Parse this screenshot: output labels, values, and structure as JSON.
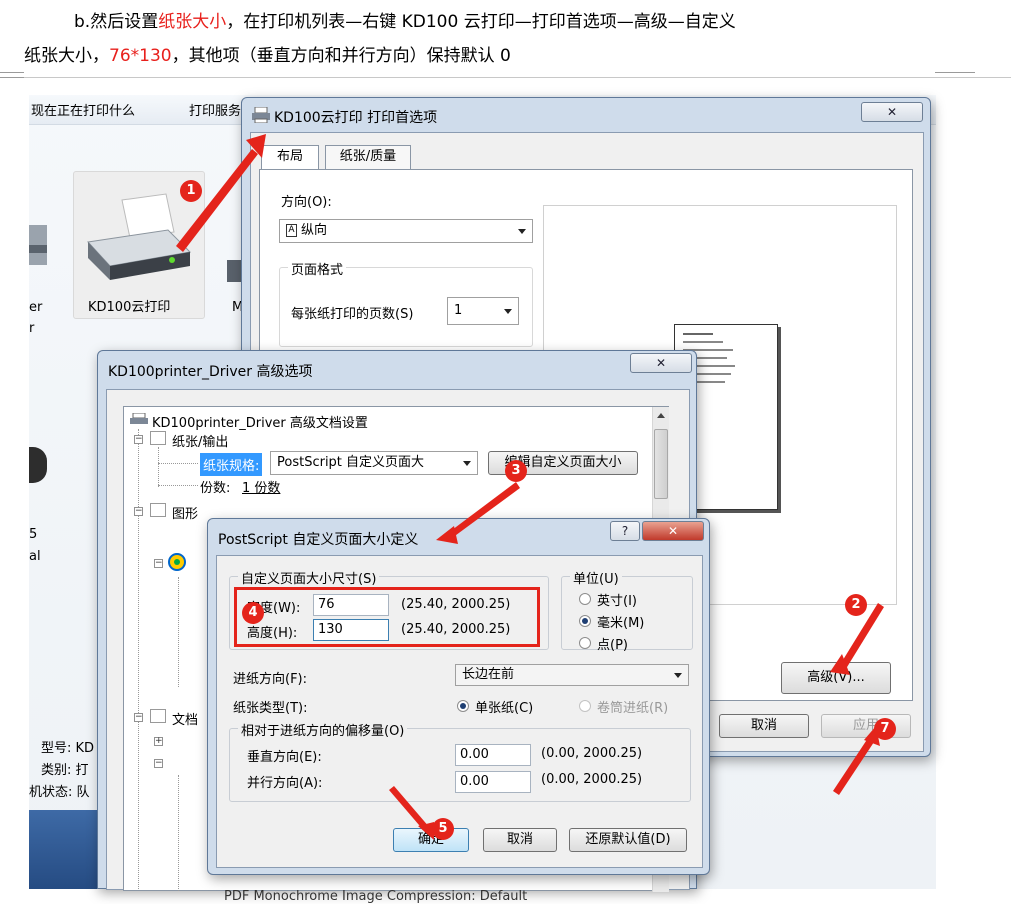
{
  "doc": {
    "line1_a": "b.然后设置",
    "line1_red": "纸张大小",
    "line1_b": "，在打印机列表—右键 KD100 云打印—打印首选项—高级—自定义",
    "line2_a": "纸张大小，",
    "line2_red": "76*130",
    "line2_b": "，其他项（垂直方向和并行方向）保持默认 0"
  },
  "explorer": {
    "toolbar_item1": "现在正在打印什么",
    "toolbar_item2": "打印服务",
    "selected_printer": "KD100云打印",
    "left_partial1": "er",
    "left_partial2": "r",
    "next_partial": "M",
    "left_partial3": "5",
    "left_partial4": "al",
    "info_model": "型号: KD",
    "info_category": "类别: 打",
    "info_status": "机状态: 队"
  },
  "prefs_dialog": {
    "title": "KD100云打印 打印首选项",
    "close": "✕",
    "tabs": [
      "布局",
      "纸张/质量"
    ],
    "orientation_label": "方向(O):",
    "orientation_value": "纵向",
    "page_format_label": "页面格式",
    "pages_per_sheet_label": "每张纸打印的页数(S)",
    "pages_per_sheet_value": "1",
    "advanced_button": "高级(V)...",
    "cancel_button": "取消",
    "apply_button": "应用"
  },
  "advanced_dialog": {
    "title": "KD100printer_Driver 高级选项",
    "close": "✕",
    "tree_root": "KD100printer_Driver 高级文档设置",
    "tree_paper_output": "纸张/输出",
    "paper_size_label": "纸张规格:",
    "paper_size_value": "PostScript 自定义页面大",
    "edit_custom_button": "编辑自定义页面大小",
    "copies_label": "份数:",
    "copies_value": "1 份数",
    "tree_graphics": "图形",
    "tree_document": "文档",
    "bottom_partial": "PDF Monochrome Image Compression: Default"
  },
  "custom_dialog": {
    "title": "PostScript 自定义页面大小定义",
    "help": "?",
    "close": "✕",
    "size_group": "自定义页面大小尺寸(S)",
    "width_label": "宽度(W):",
    "width_value": "76",
    "width_range": "(25.40, 2000.25)",
    "height_label": "高度(H):",
    "height_value": "130",
    "height_range": "(25.40, 2000.25)",
    "unit_group": "单位(U)",
    "unit_inch": "英寸(I)",
    "unit_mm": "毫米(M)",
    "unit_point": "点(P)",
    "feed_direction_label": "进纸方向(F):",
    "feed_direction_value": "长边在前",
    "paper_type_label": "纸张类型(T):",
    "paper_type_sheet": "单张纸(C)",
    "paper_type_roll": "卷筒进纸(R)",
    "offset_group": "相对于进纸方向的偏移量(O)",
    "vertical_label": "垂直方向(E):",
    "vertical_value": "0.00",
    "vertical_range": "(0.00, 2000.25)",
    "parallel_label": "并行方向(A):",
    "parallel_value": "0.00",
    "parallel_range": "(0.00, 2000.25)",
    "ok_button": "确定",
    "cancel_button": "取消",
    "restore_button": "还原默认值(D)"
  },
  "badges": [
    "1",
    "2",
    "3",
    "4",
    "5",
    "7"
  ],
  "colors": {
    "annotation": "#e4241b",
    "highlight": "#3399ff"
  }
}
